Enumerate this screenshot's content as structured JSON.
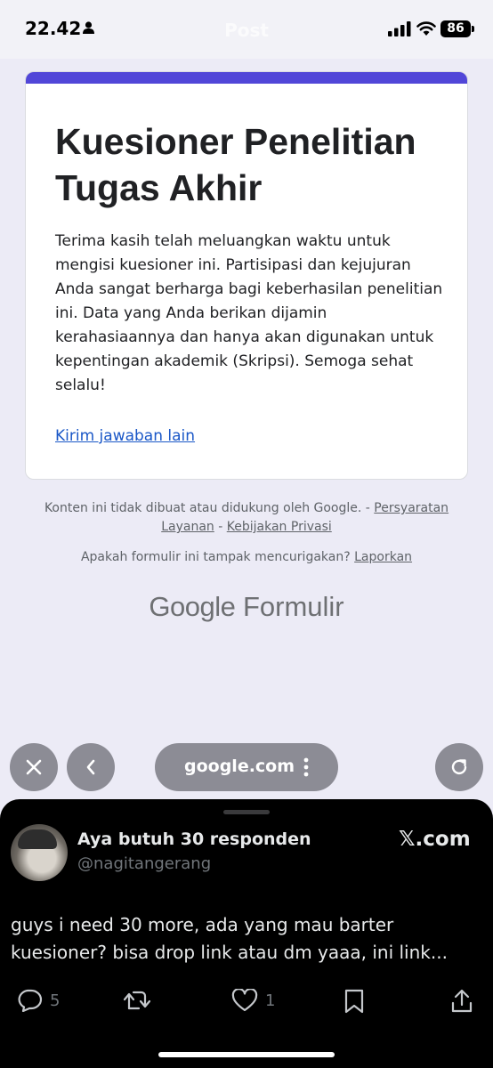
{
  "status_bar": {
    "time": "22.42",
    "ghost_title": "Post",
    "battery": "86"
  },
  "form": {
    "accent_color": "#5146d8",
    "title": "Kuesioner Penelitian Tugas Akhir",
    "message": "Terima kasih telah meluangkan waktu untuk mengisi kuesioner ini. Partisipasi dan kejujuran Anda sangat berharga bagi keberhasilan penelitian ini. Data yang Anda berikan dijamin kerahasiaannya dan hanya akan digunakan untuk kepentingan akademik (Skripsi). Semoga sehat selalu!",
    "link_label": "Kirim jawaban lain"
  },
  "footer": {
    "disclaimer": "Konten ini tidak dibuat atau didukung oleh Google. -",
    "terms_label": "Persyaratan Layanan",
    "separator": "-",
    "privacy_label": "Kebijakan Privasi",
    "report_question": "Apakah formulir ini tampak mencurigakan?",
    "report_label": "Laporkan",
    "logo_google": "Google",
    "logo_product": "Formulir"
  },
  "browser": {
    "url": "google.com",
    "icons": [
      "close-icon",
      "back-icon",
      "more-vertical-icon",
      "reload-icon"
    ]
  },
  "tweet": {
    "author_name": "Aya butuh 30 responden",
    "handle": "@nagitangerang",
    "source": "𝕏.com",
    "text": "guys i need 30 more, ada yang mau barter kuesioner? bisa drop link atau dm yaaa, ini link...",
    "reply_count": "5",
    "like_count": "1",
    "icons": [
      "reply-icon",
      "retweet-icon",
      "like-icon",
      "bookmark-icon",
      "share-icon"
    ]
  }
}
